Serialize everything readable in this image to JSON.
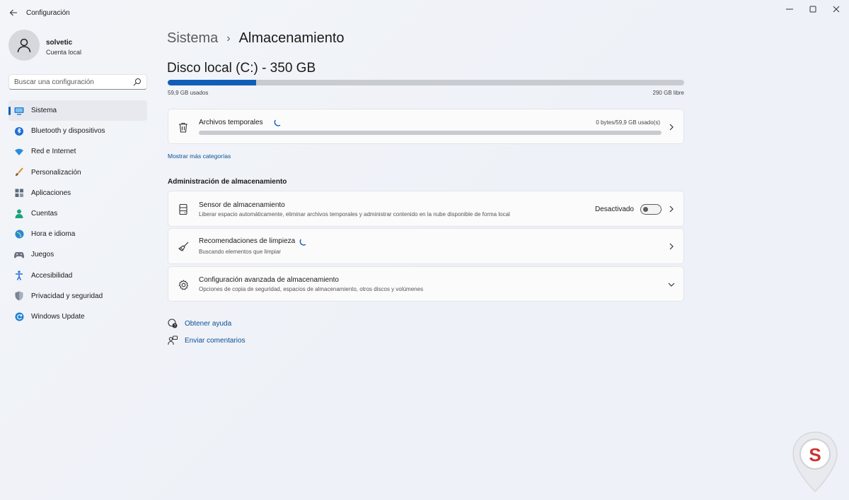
{
  "window": {
    "title": "Configuración",
    "controls": [
      "minimize-icon",
      "maximize-icon",
      "close-icon"
    ]
  },
  "profile": {
    "name": "solvetic",
    "subtitle": "Cuenta local"
  },
  "search": {
    "placeholder": "Buscar una configuración"
  },
  "sidebar": {
    "items": [
      {
        "label": "Sistema",
        "icon": "system-icon",
        "active": true
      },
      {
        "label": "Bluetooth y dispositivos",
        "icon": "bluetooth-icon"
      },
      {
        "label": "Red e Internet",
        "icon": "wifi-icon"
      },
      {
        "label": "Personalización",
        "icon": "brush-icon"
      },
      {
        "label": "Aplicaciones",
        "icon": "apps-icon"
      },
      {
        "label": "Cuentas",
        "icon": "account-icon"
      },
      {
        "label": "Hora e idioma",
        "icon": "globe-icon"
      },
      {
        "label": "Juegos",
        "icon": "gamepad-icon"
      },
      {
        "label": "Accesibilidad",
        "icon": "accessibility-icon"
      },
      {
        "label": "Privacidad y seguridad",
        "icon": "shield-icon"
      },
      {
        "label": "Windows Update",
        "icon": "update-icon"
      }
    ]
  },
  "breadcrumb": {
    "parent": "Sistema",
    "separator": "›",
    "current": "Almacenamiento"
  },
  "disk": {
    "title": "Disco local (C:) - 350 GB",
    "used": "59,9 GB usados",
    "free": "290 GB libre",
    "used_fraction": 0.171
  },
  "temp_files": {
    "title": "Archivos temporales",
    "value": "0 bytes/59,9 GB usado(s)",
    "fraction": 0.0
  },
  "more_categories": "Mostrar más categorías",
  "storage_management": {
    "heading": "Administración de almacenamiento",
    "sensor": {
      "title": "Sensor de almacenamiento",
      "subtitle": "Liberar espacio automáticamente, eliminar archivos temporales y administrar contenido en la nube disponible de forma local",
      "toggle_label": "Desactivado",
      "enabled": false
    },
    "cleanup": {
      "title": "Recomendaciones de limpieza",
      "subtitle": "Buscando elementos que limpiar"
    },
    "advanced": {
      "title": "Configuración avanzada de almacenamiento",
      "subtitle": "Opciones de copia de seguridad, espacios de almacenamiento, otros discos y volúmenes"
    }
  },
  "help_links": {
    "help": "Obtener ayuda",
    "feedback": "Enviar comentarios"
  },
  "colors": {
    "accent": "#0f5fb8",
    "link": "#0a4f94"
  }
}
